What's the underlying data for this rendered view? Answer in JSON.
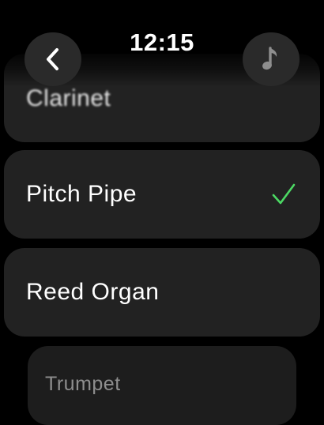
{
  "header": {
    "time": "12:15",
    "back_icon": "chevron-left-icon",
    "music_icon": "music-note-icon"
  },
  "instruments": [
    {
      "label": "Clarinet",
      "selected": false
    },
    {
      "label": "Pitch Pipe",
      "selected": true
    },
    {
      "label": "Reed Organ",
      "selected": false
    },
    {
      "label": "Trumpet",
      "selected": false
    }
  ],
  "colors": {
    "background": "#000000",
    "row": "#222222",
    "checkmark": "#4cd964",
    "dim_text": "#8e8e8e"
  }
}
